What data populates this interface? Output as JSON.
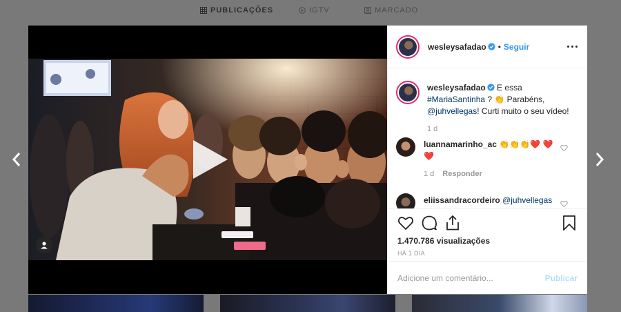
{
  "tabs": [
    {
      "label": "PUBLICAÇÕES",
      "icon": "grid-icon"
    },
    {
      "label": "IGTV",
      "icon": "igtv-icon"
    },
    {
      "label": "MARCADO",
      "icon": "tagged-icon"
    }
  ],
  "post": {
    "username": "wesleysafadao",
    "follow_label": "Seguir",
    "dot": "•",
    "caption": {
      "username": "wesleysafadao",
      "text_1": " E essa ",
      "tag": "#MariaSantinha",
      "text_2": " ? 👏 Parabéns, ",
      "mention": "@juhvellegas",
      "text_3": "! Curti muito o seu vídeo!",
      "time": "1 d"
    },
    "comments": [
      {
        "username": "luannamarinho_ac",
        "text": " 👏👏👏❤️ ❤️❤️",
        "time": "1 d",
        "reply_label": "Responder"
      },
      {
        "username": "eliissandracordeiro",
        "text": " @juhvellegas"
      }
    ],
    "views": "1.470.786 visualizações",
    "date": "HÁ 1 DIA",
    "comment_placeholder": "Adicione um comentário...",
    "publish_label": "Publicar"
  },
  "colors": {
    "accent": "#3897f0",
    "overlay": "#797979",
    "publish_disabled": "#b2dffc"
  }
}
